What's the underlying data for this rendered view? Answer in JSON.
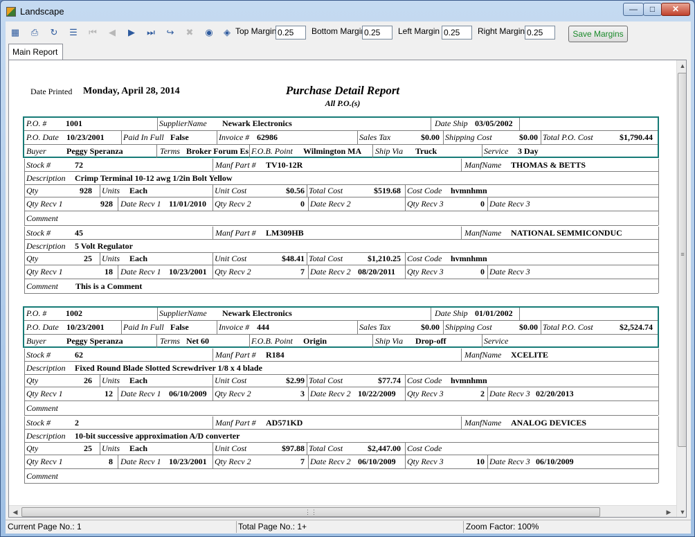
{
  "window": {
    "title": "Landscape"
  },
  "toolbar": {
    "top_margin_label": "Top Margin",
    "top_margin": "0.25",
    "bottom_margin_label": "Bottom Margin",
    "bottom_margin": "0.25",
    "left_margin_label": "Left Margin",
    "left_margin": "0.25",
    "right_margin_label": "Right Margin",
    "right_margin": "0.25",
    "save_label": "Save Margins"
  },
  "tab": {
    "label": "Main Report"
  },
  "report": {
    "date_printed_label": "Date Printed",
    "date_printed": "Monday, April 28, 2014",
    "title": "Purchase Detail Report",
    "subtitle": "All P.O.(s)",
    "labels": {
      "po": "P.O. #",
      "supplier": "SupplierName",
      "date_ship": "Date Ship",
      "po_date": "P.O. Date",
      "paid_in_full": "Paid In Full",
      "invoice": "Invoice #",
      "sales_tax": "Sales Tax",
      "shipping_cost": "Shipping Cost",
      "total_po_cost": "Total P.O. Cost",
      "buyer": "Buyer",
      "terms": "Terms",
      "fob": "F.O.B. Point",
      "ship_via": "Ship Via",
      "service": "Service",
      "stock": "Stock #",
      "manf_part": "Manf Part #",
      "manf_name": "ManfName",
      "description": "Description",
      "qty": "Qty",
      "units": "Units",
      "unit_cost": "Unit Cost",
      "total_cost": "Total Cost",
      "cost_code": "Cost Code",
      "qty_recv_1": "Qty Recv 1",
      "date_recv_1": "Date Recv 1",
      "qty_recv_2": "Qty Recv 2",
      "date_recv_2": "Date Recv 2",
      "qty_recv_3": "Qty Recv 3",
      "date_recv_3": "Date Recv 3",
      "comment": "Comment"
    },
    "pos": [
      {
        "po": "1001",
        "supplier": "Newark Electronics",
        "date_ship": "03/05/2002",
        "po_date": "10/23/2001",
        "paid_in_full": "False",
        "invoice": "62986",
        "sales_tax": "$0.00",
        "shipping_cost": "$0.00",
        "total_po_cost": "$1,790.44",
        "buyer": "Peggy Speranza",
        "terms": "Broker Forum Es",
        "fob": "Wilmington MA",
        "ship_via": "Truck",
        "service": "3 Day",
        "items": [
          {
            "stock": "72",
            "manf_part": "TV10-12R",
            "manf_name": "THOMAS & BETTS",
            "description": "Crimp Terminal 10-12 awg 1/2in Bolt Yellow",
            "qty": "928",
            "units": "Each",
            "unit_cost": "$0.56",
            "total_cost": "$519.68",
            "cost_code": "hvmnhmn",
            "qty_recv_1": "928",
            "date_recv_1": "11/01/2010",
            "qty_recv_2": "0",
            "date_recv_2": "",
            "qty_recv_3": "0",
            "date_recv_3": "",
            "comment": ""
          },
          {
            "stock": "45",
            "manf_part": "LM309HB",
            "manf_name": "NATIONAL SEMMICONDUC",
            "description": "5 Volt Regulator",
            "qty": "25",
            "units": "Each",
            "unit_cost": "$48.41",
            "total_cost": "$1,210.25",
            "cost_code": "hvmnhmn",
            "qty_recv_1": "18",
            "date_recv_1": "10/23/2001",
            "qty_recv_2": "7",
            "date_recv_2": "08/20/2011",
            "qty_recv_3": "0",
            "date_recv_3": "",
            "comment": "This is a Comment"
          }
        ]
      },
      {
        "po": "1002",
        "supplier": "Newark Electronics",
        "date_ship": "01/01/2002",
        "po_date": "10/23/2001",
        "paid_in_full": "False",
        "invoice": "444",
        "sales_tax": "$0.00",
        "shipping_cost": "$0.00",
        "total_po_cost": "$2,524.74",
        "buyer": "Peggy Speranza",
        "terms": "Net 60",
        "fob": "Origin",
        "ship_via": "Drop-off",
        "service": "",
        "items": [
          {
            "stock": "62",
            "manf_part": "R184",
            "manf_name": "XCELITE",
            "description": "Fixed Round Blade Slotted Screwdriver 1/8  x 4  blade",
            "qty": "26",
            "units": "Each",
            "unit_cost": "$2.99",
            "total_cost": "$77.74",
            "cost_code": "hvmnhmn",
            "qty_recv_1": "12",
            "date_recv_1": "06/10/2009",
            "qty_recv_2": "3",
            "date_recv_2": "10/22/2009",
            "qty_recv_3": "2",
            "date_recv_3": "02/20/2013",
            "comment": ""
          },
          {
            "stock": "2",
            "manf_part": "AD571KD",
            "manf_name": "ANALOG DEVICES",
            "description": "10-bit successive approximation A/D converter",
            "qty": "25",
            "units": "Each",
            "unit_cost": "$97.88",
            "total_cost": "$2,447.00",
            "cost_code": "",
            "qty_recv_1": "8",
            "date_recv_1": "10/23/2001",
            "qty_recv_2": "7",
            "date_recv_2": "06/10/2009",
            "qty_recv_3": "10",
            "date_recv_3": "06/10/2009",
            "comment": ""
          }
        ]
      }
    ]
  },
  "status": {
    "current_page": "Current Page No.: 1",
    "total_page": "Total Page No.: 1+",
    "zoom": "Zoom Factor: 100%"
  }
}
